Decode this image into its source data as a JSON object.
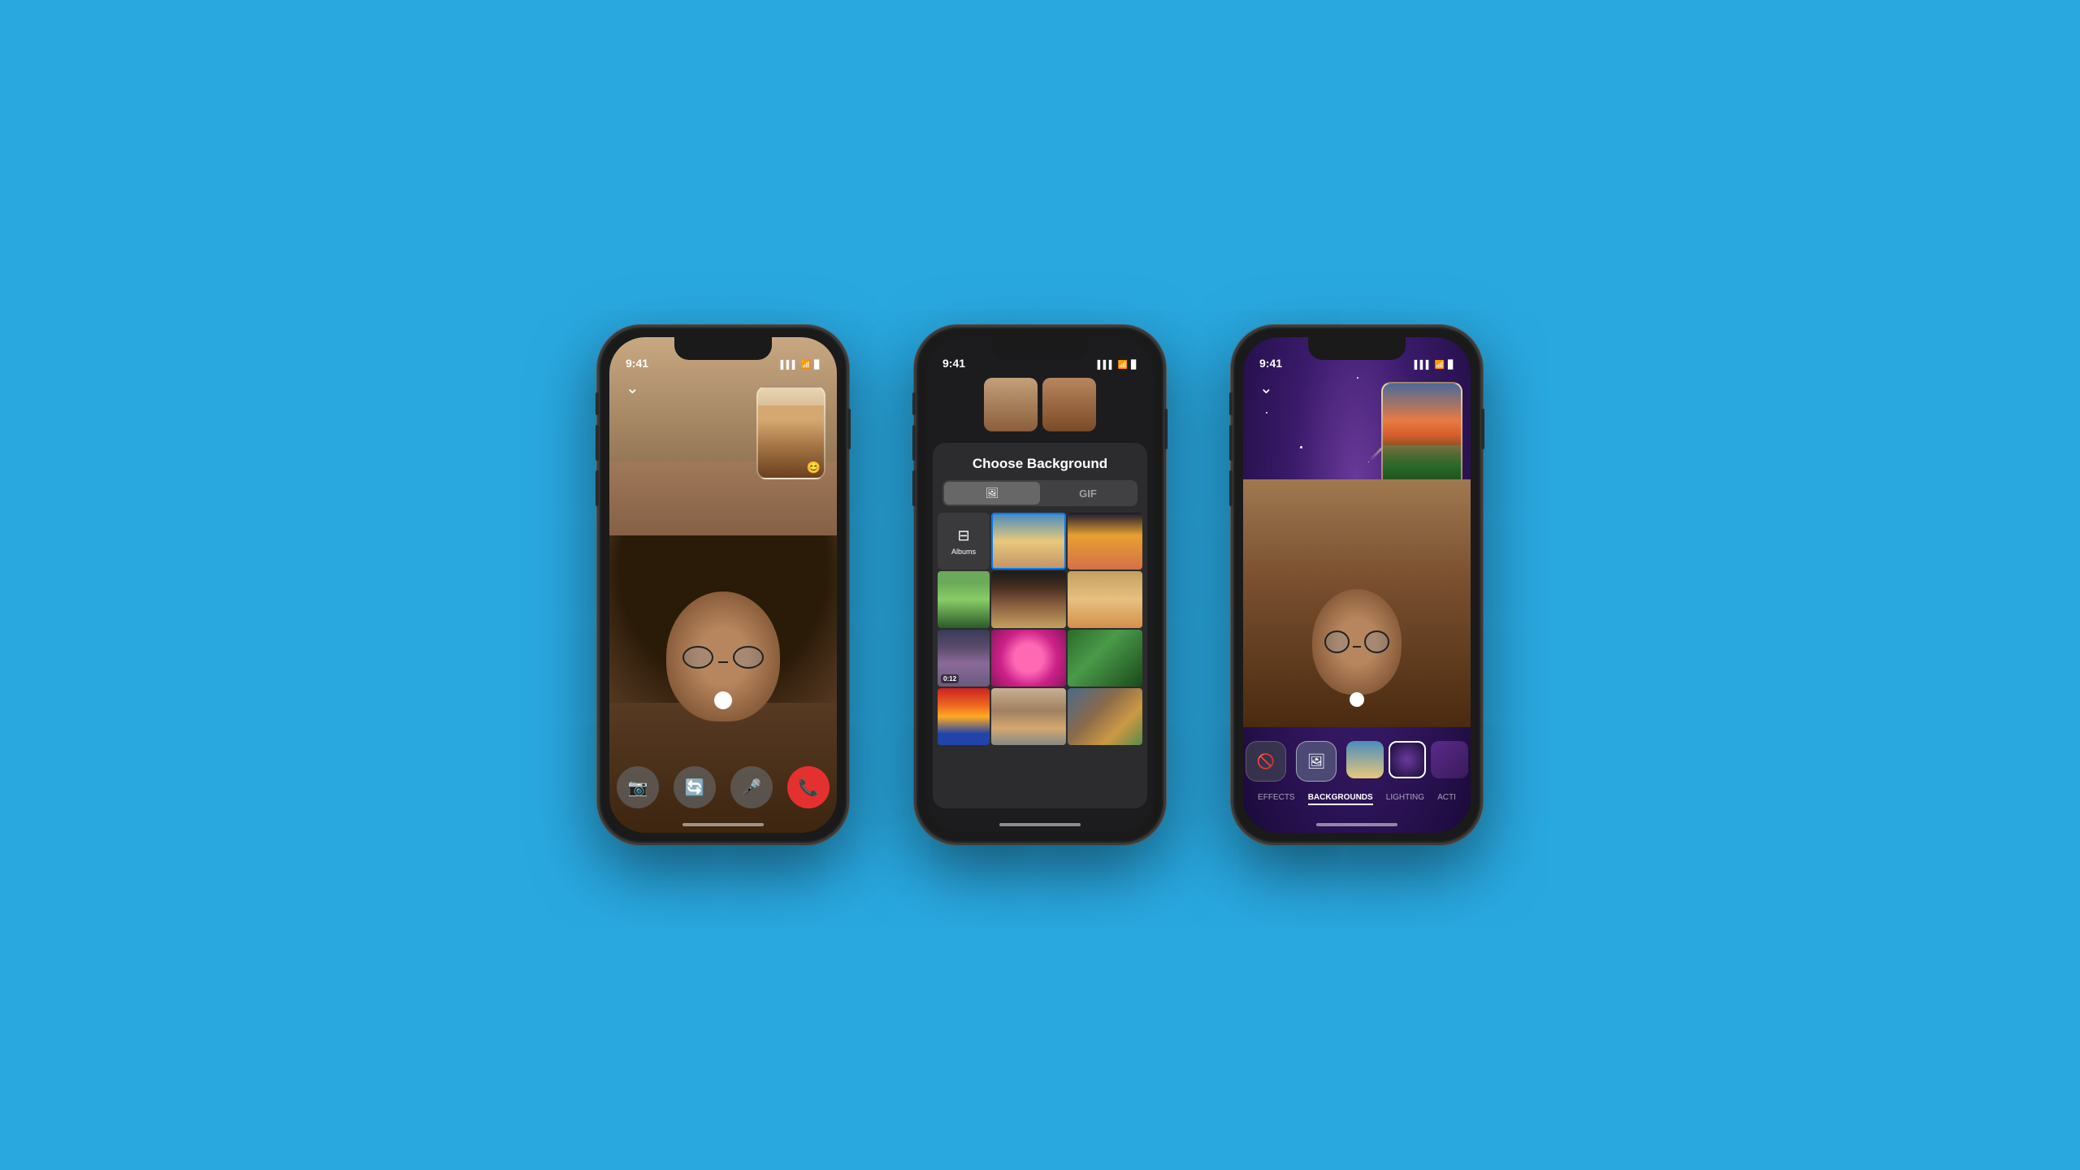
{
  "background_color": "#29a8e0",
  "phones": {
    "phone1": {
      "status_time": "9:41",
      "chevron": "›",
      "controls": [
        "📹",
        "🔄",
        "🎤",
        "📞"
      ],
      "control_labels": [
        "video",
        "flip",
        "mic",
        "end"
      ]
    },
    "phone2": {
      "status_time": "9:41",
      "title": "Choose Background",
      "tab_photos": "🖼",
      "tab_gif": "GIF",
      "albums_label": "Albums",
      "photo_tab_label": "Photos"
    },
    "phone3": {
      "status_time": "9:41",
      "effects_tab": "EFFECTS",
      "backgrounds_tab": "BACKGROUNDS",
      "lighting_tab": "LIGHTING",
      "actions_tab": "ACTI"
    }
  }
}
